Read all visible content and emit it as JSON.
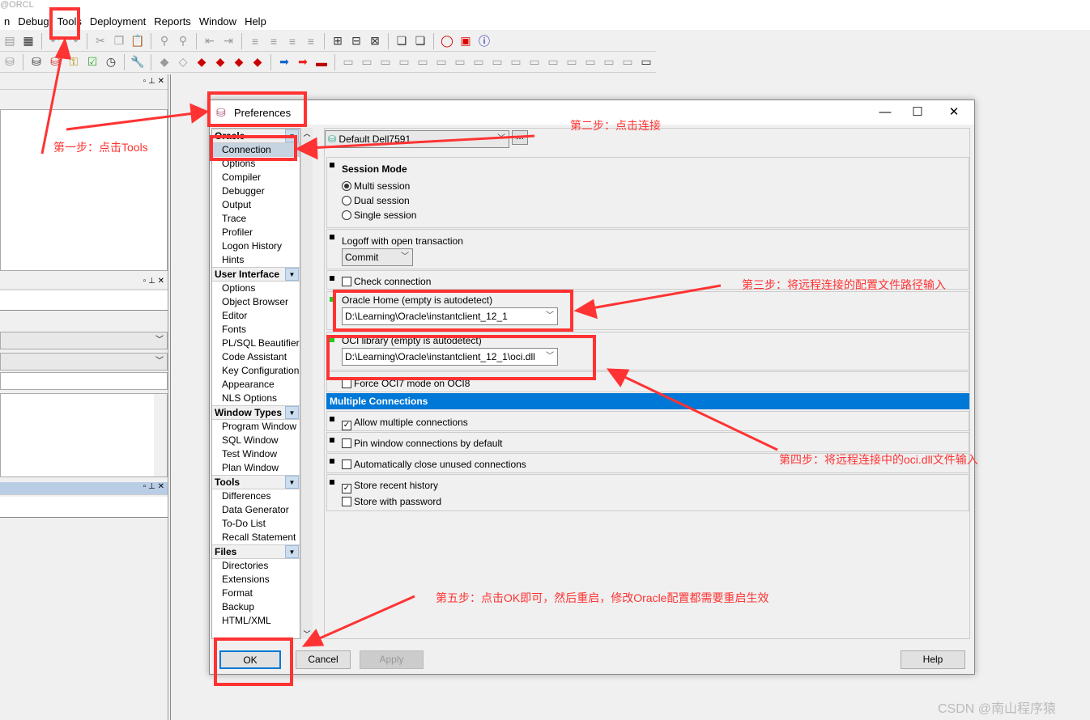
{
  "app": {
    "title_partial": "@ORCL"
  },
  "menu": [
    "n",
    "Debug",
    "Tools",
    "Deployment",
    "Reports",
    "Window",
    "Help"
  ],
  "dialog": {
    "title": "Preferences",
    "connection_combo": "Default Dell7591",
    "ellipsis": "...",
    "tree": [
      {
        "group": "Oracle",
        "items": [
          "Connection",
          "Options",
          "Compiler",
          "Debugger",
          "Output",
          "Trace",
          "Profiler",
          "Logon History",
          "Hints"
        ]
      },
      {
        "group": "User Interface",
        "items": [
          "Options",
          "Object Browser",
          "Editor",
          "Fonts",
          "PL/SQL Beautifier",
          "Code Assistant",
          "Key Configuration",
          "Appearance",
          "NLS Options"
        ]
      },
      {
        "group": "Window Types",
        "items": [
          "Program Window",
          "SQL Window",
          "Test Window",
          "Plan Window"
        ]
      },
      {
        "group": "Tools",
        "items": [
          "Differences",
          "Data Generator",
          "To-Do List",
          "Recall Statement"
        ]
      },
      {
        "group": "Files",
        "items": [
          "Directories",
          "Extensions",
          "Format",
          "Backup",
          "HTML/XML"
        ]
      }
    ],
    "selected_item": "Connection",
    "session_mode": {
      "title": "Session Mode",
      "options": [
        "Multi session",
        "Dual session",
        "Single session"
      ],
      "selected": "Multi session"
    },
    "logoff": {
      "label": "Logoff with open transaction",
      "value": "Commit"
    },
    "check_connection": {
      "label": "Check connection",
      "checked": false
    },
    "oracle_home": {
      "label": "Oracle Home (empty is autodetect)",
      "value": "D:\\Learning\\Oracle\\instantclient_12_1"
    },
    "oci_library": {
      "label": "OCI library (empty is autodetect)",
      "value": "D:\\Learning\\Oracle\\instantclient_12_1\\oci.dll"
    },
    "force_oci7": {
      "label": "Force OCI7 mode on OCI8",
      "checked": false
    },
    "multiple_connections": {
      "header": "Multiple Connections",
      "allow": {
        "label": "Allow multiple connections",
        "checked": true
      },
      "pin": {
        "label": "Pin window connections by default",
        "checked": false
      },
      "auto_close": {
        "label": "Automatically close unused connections",
        "checked": false
      },
      "store_history": {
        "label": "Store recent history",
        "checked": true
      },
      "store_password": {
        "label": "Store with password",
        "checked": false
      }
    },
    "buttons": {
      "ok": "OK",
      "cancel": "Cancel",
      "apply": "Apply",
      "help": "Help"
    }
  },
  "annotations": {
    "step1": "第一步：点击Tools",
    "step2": "第二步：点击连接",
    "step3": "第三步：将远程连接的配置文件路径输入",
    "step4": "第四步：将远程连接中的oci.dll文件输入",
    "step5": "第五步：点击OK即可，然后重启，修改Oracle配置都需要重启生效"
  },
  "watermark": "CSDN @南山程序猿",
  "colors": {
    "annotation": "#ff3333",
    "section_header": "#0078d7",
    "selected": "#c6d3e0"
  }
}
